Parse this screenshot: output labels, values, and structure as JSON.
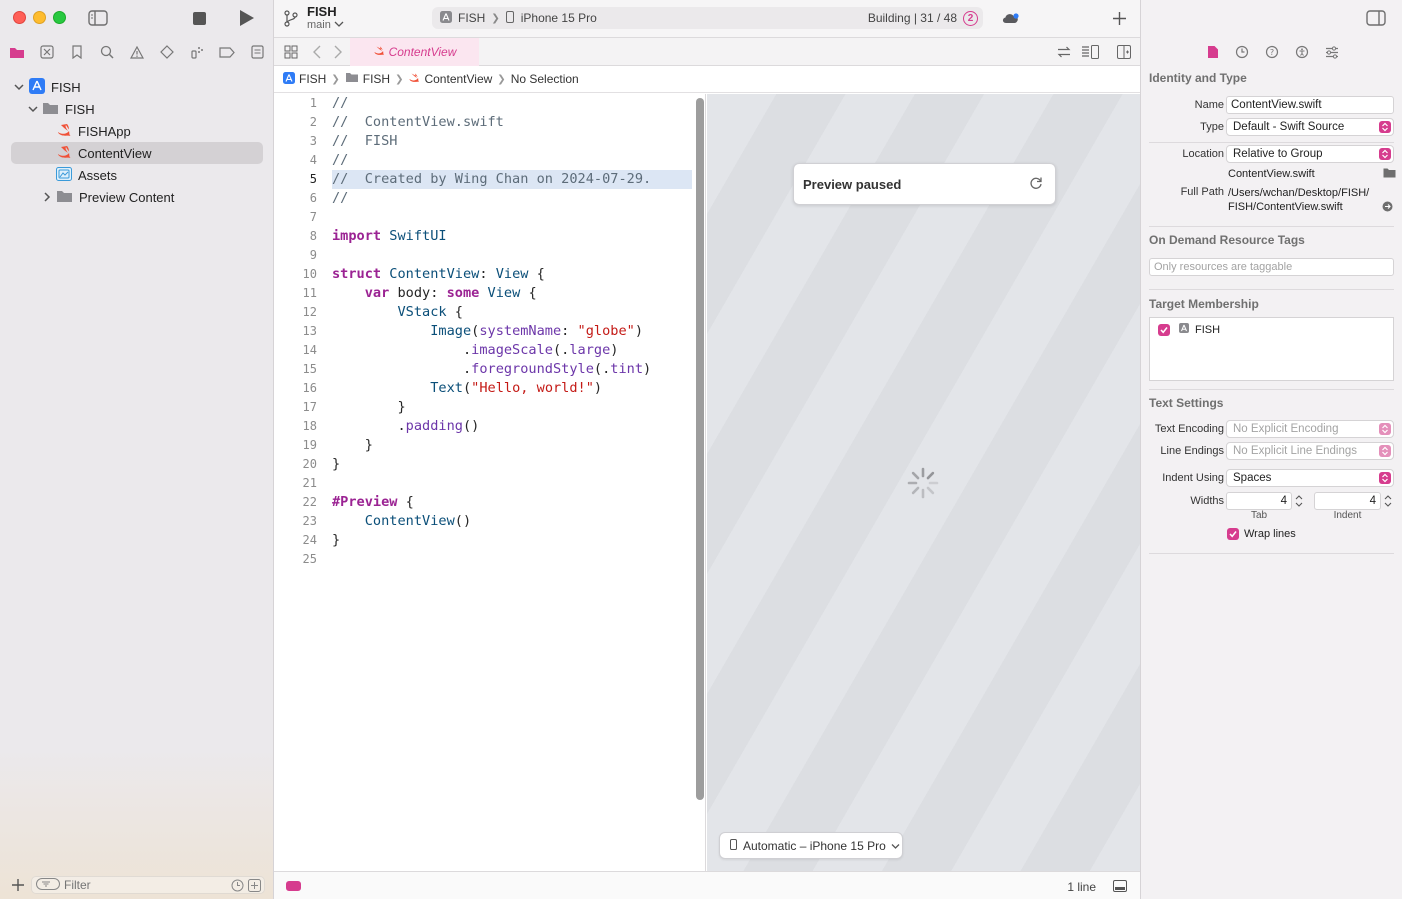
{
  "navigator": {
    "tree": [
      {
        "label": "FISH",
        "kind": "project",
        "expanded": true
      },
      {
        "label": "FISH",
        "kind": "folder",
        "expanded": true
      },
      {
        "label": "FISHApp",
        "kind": "swift"
      },
      {
        "label": "ContentView",
        "kind": "swift",
        "selected": true
      },
      {
        "label": "Assets",
        "kind": "assets"
      },
      {
        "label": "Preview Content",
        "kind": "folder",
        "expanded": false
      }
    ],
    "filter_placeholder": "Filter"
  },
  "toolbar": {
    "project": "FISH",
    "branch": "main",
    "scheme": "FISH",
    "destination": "iPhone 15 Pro",
    "status": "Building | 31 / 48",
    "issue_count": "2"
  },
  "tabs": [
    {
      "label": "ContentView",
      "active": true
    }
  ],
  "jumpbar": [
    "FISH",
    "FISH",
    "ContentView",
    "No Selection"
  ],
  "editor": {
    "current_line": 5,
    "lines": [
      "//",
      "//  ContentView.swift",
      "//  FISH",
      "//",
      "//  Created by Wing Chan on 2024-07-29.",
      "//",
      "",
      "import SwiftUI",
      "",
      "struct ContentView: View {",
      "    var body: some View {",
      "        VStack {",
      "            Image(systemName: \"globe\")",
      "                .imageScale(.large)",
      "                .foregroundStyle(.tint)",
      "            Text(\"Hello, world!\")",
      "        }",
      "        .padding()",
      "    }",
      "}",
      "",
      "#Preview {",
      "    ContentView()",
      "}",
      ""
    ]
  },
  "preview": {
    "status_title": "Preview paused",
    "device_label": "Automatic – iPhone 15 Pro"
  },
  "statusbar": {
    "lines": "1 line"
  },
  "inspector": {
    "identity": {
      "title": "Identity and Type",
      "name_label": "Name",
      "name_value": "ContentView.swift",
      "type_label": "Type",
      "type_value": "Default - Swift Source",
      "location_label": "Location",
      "location_value": "Relative to Group",
      "location_file": "ContentView.swift",
      "fullpath_label": "Full Path",
      "fullpath_value_1": "/Users/wchan/Desktop/FISH/",
      "fullpath_value_2": "FISH/ContentView.swift"
    },
    "odr": {
      "title": "On Demand Resource Tags",
      "placeholder": "Only resources are taggable"
    },
    "target": {
      "title": "Target Membership",
      "items": [
        {
          "label": "FISH",
          "checked": true
        }
      ]
    },
    "text_settings": {
      "title": "Text Settings",
      "encoding_label": "Text Encoding",
      "encoding_value": "No Explicit Encoding",
      "endings_label": "Line Endings",
      "endings_value": "No Explicit Line Endings",
      "indent_label": "Indent Using",
      "indent_value": "Spaces",
      "widths_label": "Widths",
      "tab_value": "4",
      "tab_caption": "Tab",
      "indent_width_value": "4",
      "indent_caption": "Indent",
      "wrap_label": "Wrap lines",
      "wrap_checked": true
    }
  },
  "colors": {
    "accent": "#d63c8e",
    "keyword": "#9b2393",
    "type": "#0b4f79",
    "string": "#c41a16",
    "comment": "#5d6c79",
    "function": "#6c36a9"
  }
}
